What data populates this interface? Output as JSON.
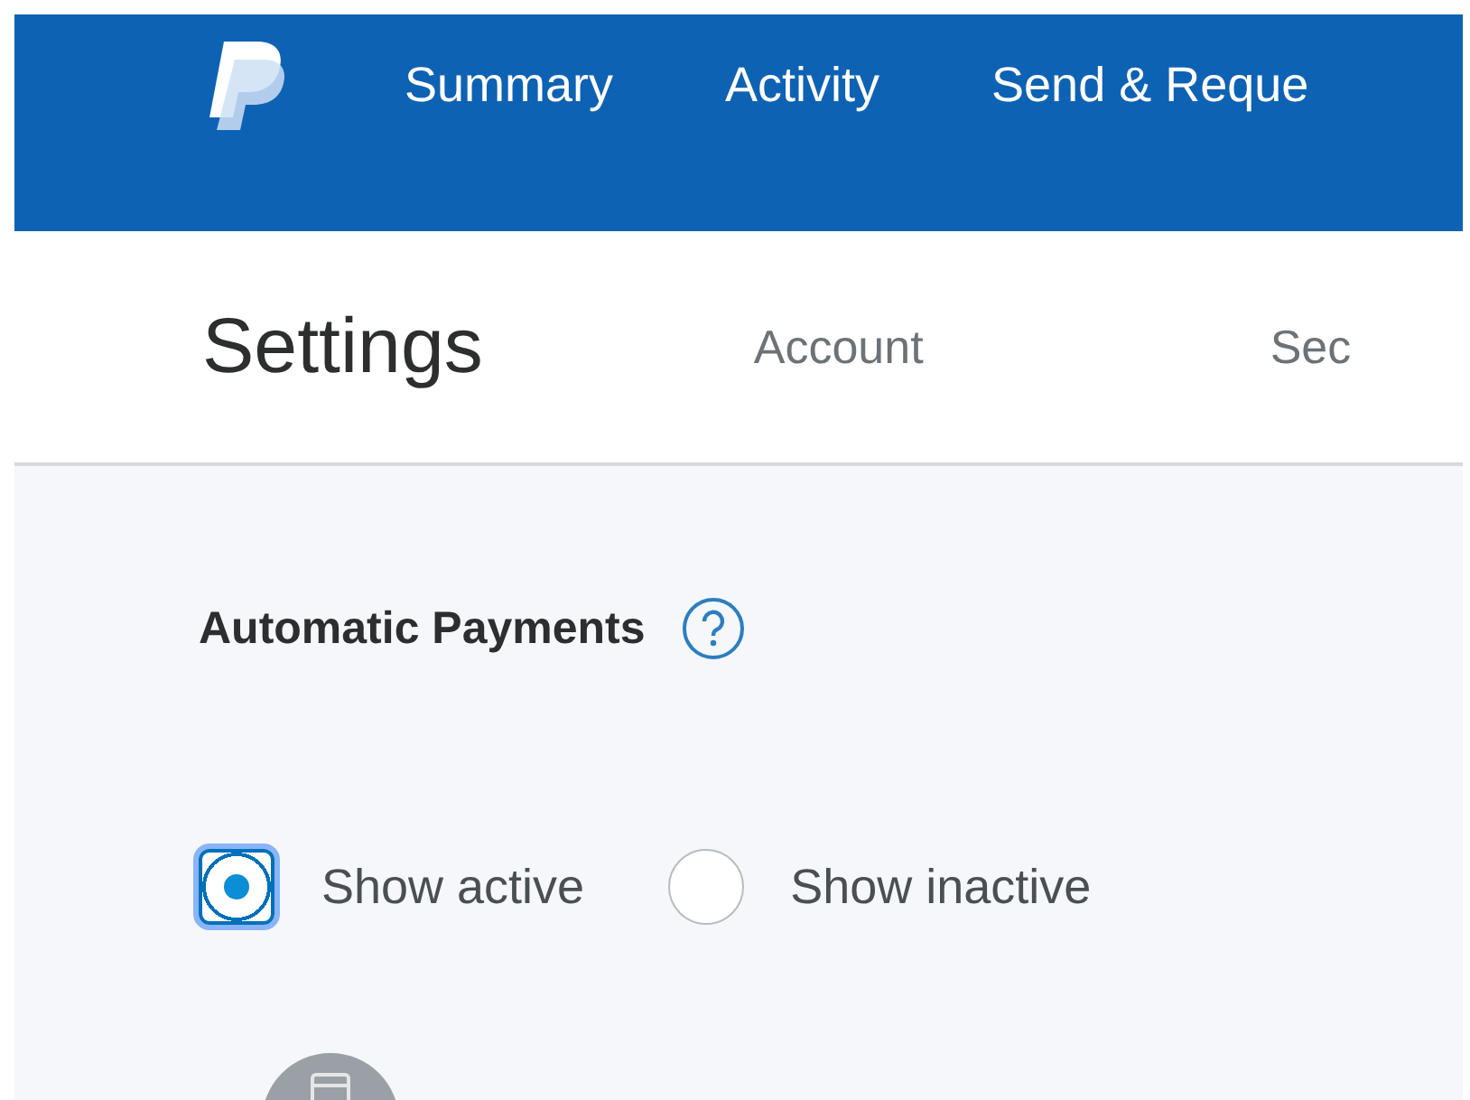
{
  "nav": {
    "items": [
      {
        "label": "Summary"
      },
      {
        "label": "Activity"
      },
      {
        "label": "Send & Reque"
      }
    ]
  },
  "settings": {
    "title": "Settings",
    "tabs": [
      {
        "label": "Account"
      },
      {
        "label": "Sec"
      }
    ]
  },
  "section": {
    "title": "Automatic Payments",
    "filters": [
      {
        "label": "Show active",
        "selected": true
      },
      {
        "label": "Show inactive",
        "selected": false
      }
    ]
  }
}
